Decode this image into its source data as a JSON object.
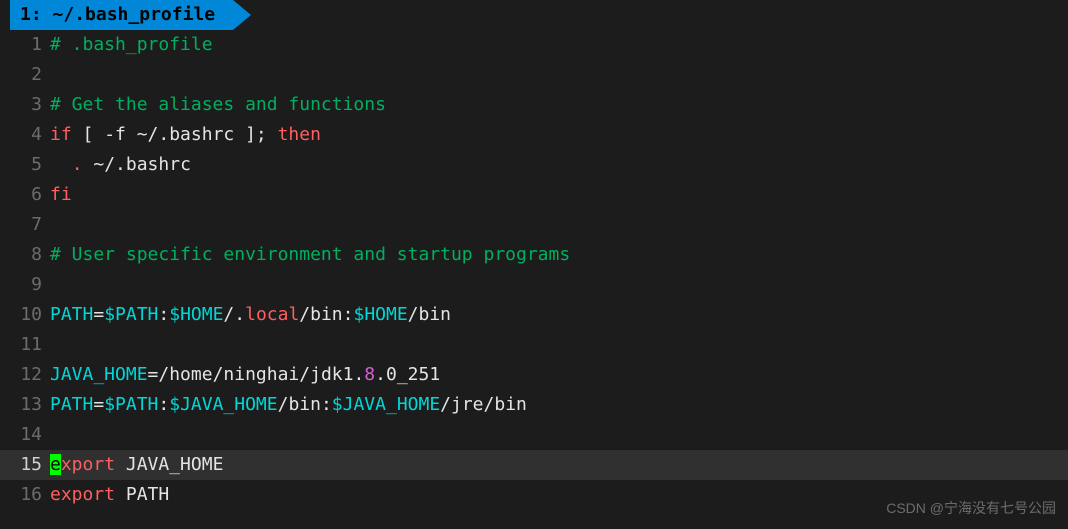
{
  "tab": {
    "index": "1",
    "title": "~/.bash_profile"
  },
  "cursor_line": 15,
  "lines": [
    {
      "n": 1,
      "tokens": [
        {
          "c": "cm",
          "t": "# .bash_profile"
        }
      ]
    },
    {
      "n": 2,
      "tokens": []
    },
    {
      "n": 3,
      "tokens": [
        {
          "c": "cm",
          "t": "# Get the aliases and functions"
        }
      ]
    },
    {
      "n": 4,
      "tokens": [
        {
          "c": "kw",
          "t": "if"
        },
        {
          "c": "pl",
          "t": " [ -f ~/.bashrc ]; "
        },
        {
          "c": "kw",
          "t": "then"
        }
      ]
    },
    {
      "n": 5,
      "tokens": [
        {
          "c": "pl",
          "t": "  "
        },
        {
          "c": "kw",
          "t": "."
        },
        {
          "c": "pl",
          "t": " ~/.bashrc"
        }
      ]
    },
    {
      "n": 6,
      "tokens": [
        {
          "c": "kw",
          "t": "fi"
        }
      ]
    },
    {
      "n": 7,
      "tokens": []
    },
    {
      "n": 8,
      "tokens": [
        {
          "c": "cm",
          "t": "# User specific environment and startup programs"
        }
      ]
    },
    {
      "n": 9,
      "tokens": []
    },
    {
      "n": 10,
      "tokens": [
        {
          "c": "fn",
          "t": "PATH"
        },
        {
          "c": "pl",
          "t": "="
        },
        {
          "c": "fn",
          "t": "$PATH"
        },
        {
          "c": "pl",
          "t": ":"
        },
        {
          "c": "fn",
          "t": "$HOME"
        },
        {
          "c": "pl",
          "t": "/."
        },
        {
          "c": "kw",
          "t": "local"
        },
        {
          "c": "pl",
          "t": "/bin:"
        },
        {
          "c": "fn",
          "t": "$HOME"
        },
        {
          "c": "pl",
          "t": "/bin"
        }
      ]
    },
    {
      "n": 11,
      "tokens": []
    },
    {
      "n": 12,
      "tokens": [
        {
          "c": "fn",
          "t": "JAVA_HOME"
        },
        {
          "c": "pl",
          "t": "=/home/ninghai/jdk1."
        },
        {
          "c": "num",
          "t": "8"
        },
        {
          "c": "pl",
          "t": ".0_251"
        }
      ]
    },
    {
      "n": 13,
      "tokens": [
        {
          "c": "fn",
          "t": "PATH"
        },
        {
          "c": "pl",
          "t": "="
        },
        {
          "c": "fn",
          "t": "$PATH"
        },
        {
          "c": "pl",
          "t": ":"
        },
        {
          "c": "fn",
          "t": "$JAVA_HOME"
        },
        {
          "c": "pl",
          "t": "/bin:"
        },
        {
          "c": "fn",
          "t": "$JAVA_HOME"
        },
        {
          "c": "pl",
          "t": "/jre/bin"
        }
      ]
    },
    {
      "n": 14,
      "tokens": []
    },
    {
      "n": 15,
      "tokens": [
        {
          "c": "cursor",
          "t": "e"
        },
        {
          "c": "kw",
          "t": "xport"
        },
        {
          "c": "pl",
          "t": " JAVA_HOME"
        }
      ]
    },
    {
      "n": 16,
      "tokens": [
        {
          "c": "kw",
          "t": "export"
        },
        {
          "c": "pl",
          "t": " PATH"
        }
      ]
    }
  ],
  "watermark": "CSDN @宁海没有七号公园"
}
